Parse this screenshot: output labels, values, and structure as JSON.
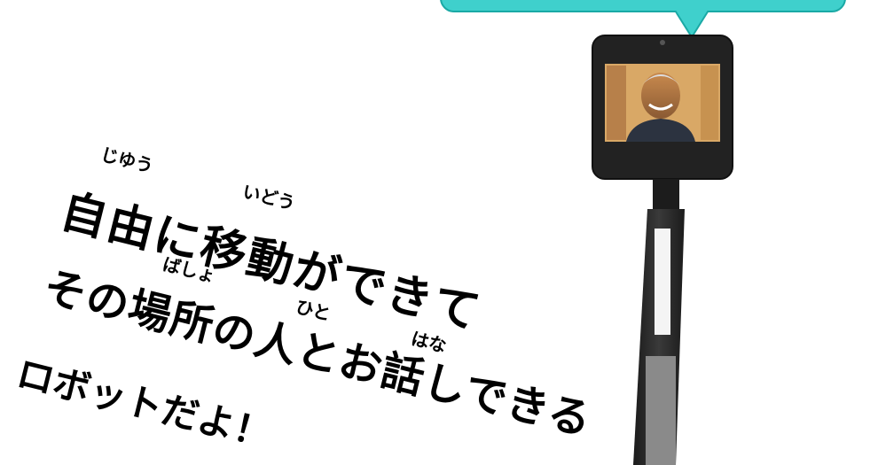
{
  "caption": {
    "line1": "自由に移動ができて",
    "line2": "その場所の人とお話しできる",
    "line3": "ロボットだよ！"
  },
  "ruby": {
    "jiyuu": "じゆう",
    "idou": "いどう",
    "basho": "ばしょ",
    "hito": "ひと",
    "hana": "はな"
  },
  "colors": {
    "bubble": "#3fd0cc",
    "bubble_border": "#1aa9a5",
    "robot_body": "#2a2a2a",
    "text": "#000000"
  }
}
